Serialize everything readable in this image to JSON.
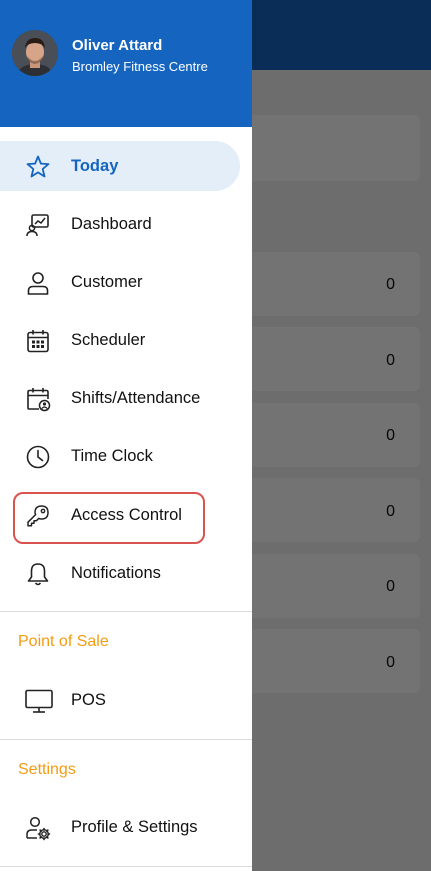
{
  "user": {
    "name": "Oliver Attard",
    "organization": "Bromley Fitness Centre"
  },
  "menu": [
    {
      "label": "Today",
      "icon": "star-icon",
      "active": true
    },
    {
      "label": "Dashboard",
      "icon": "dashboard-icon",
      "active": false
    },
    {
      "label": "Customer",
      "icon": "person-icon",
      "active": false
    },
    {
      "label": "Scheduler",
      "icon": "calendar-icon",
      "active": false
    },
    {
      "label": "Shifts/Attendance",
      "icon": "calendar-person-icon",
      "active": false
    },
    {
      "label": "Time Clock",
      "icon": "clock-icon",
      "active": false
    },
    {
      "label": "Access Control",
      "icon": "key-icon",
      "active": false,
      "highlighted": true
    },
    {
      "label": "Notifications",
      "icon": "bell-icon",
      "active": false
    }
  ],
  "sections": {
    "pos_title": "Point of Sale",
    "pos_item": "POS",
    "settings_title": "Settings",
    "settings_item": "Profile & Settings"
  },
  "background_counts": [
    "0",
    "0",
    "0",
    "0",
    "0",
    "0"
  ],
  "colors": {
    "primary": "#1565c0",
    "active_bg": "#e3eef9",
    "section_title": "#f39c12",
    "highlight": "#d9534f"
  }
}
